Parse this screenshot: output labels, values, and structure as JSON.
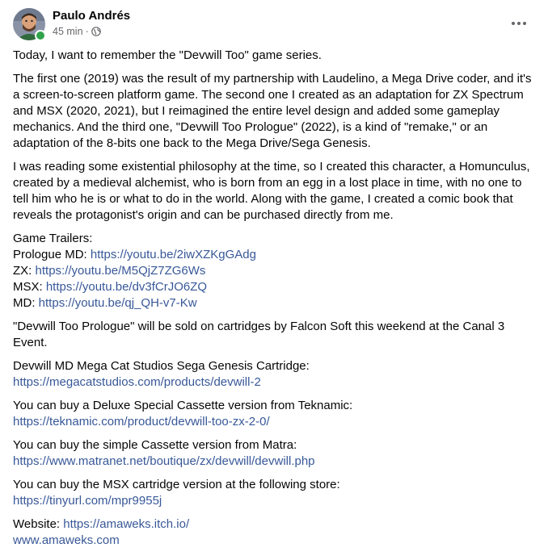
{
  "post": {
    "author": "Paulo Andrés",
    "time": "45 min",
    "dot": "·",
    "icons": {
      "avatar": "avatar-icon",
      "globe": "globe-icon",
      "more": "more-options-icon"
    },
    "colors": {
      "link": "#385898",
      "online": "#31a24c",
      "meta": "#65676b"
    }
  },
  "body": {
    "p1": "Today, I want to remember the \"Devwill Too\" game series.",
    "p2": [
      "The first one (2019) was the result of my partnership with Laudelino, a Mega Drive coder, and it's",
      "a screen-to-screen platform game. The second one I created as an adaptation for ZX Spectrum",
      "and MSX (2020, 2021), but I reimagined the entire level design and added some gameplay",
      "mechanics. And the third one, \"Devwill Too Prologue\" (2022), is a kind of \"remake,\" or an",
      "adaptation of the  8-bits one back to the Mega Drive/Sega Genesis."
    ],
    "p3": [
      "I was reading some existential philosophy at the time, so I created this character, a Homunculus,",
      "created by a medieval alchemist, who is born from an egg in a lost place in time, with no one to",
      "tell him who he is or what to do in the world. Along with the game, I created a comic book that",
      "reveals the protagonist's origin and can be purchased directly from me."
    ],
    "trailers_heading": "Game Trailers:",
    "trailers": [
      {
        "label": "Prologue MD: ",
        "link": "https://youtu.be/2iwXZKgGAdg"
      },
      {
        "label": "ZX: ",
        "link": "https://youtu.be/M5QjZ7ZG6Ws"
      },
      {
        "label": "MSX: ",
        "link": "https://youtu.be/dv3fCrJO6ZQ"
      },
      {
        "label": "MD: ",
        "link": "https://youtu.be/qj_QH-v7-Kw"
      }
    ],
    "p_sold": "\"Devwill Too Prologue\" will be sold on cartridges by Falcon Soft this weekend at the Canal 3 Event.",
    "stores": [
      {
        "text": "Devwill MD Mega Cat Studios Sega Genesis Cartridge:",
        "link": "https://megacatstudios.com/products/devwill-2"
      },
      {
        "text": "You can buy a Deluxe Special Cassette version from Teknamic:",
        "link": "https://teknamic.com/product/devwill-too-zx-2-0/"
      },
      {
        "text": "You can buy the simple Cassette version from Matra:",
        "link": "https://www.matranet.net/boutique/zx/devwill/devwill.php"
      },
      {
        "text": "You can buy the MSX cartridge version at the following store:",
        "link": "https://tinyurl.com/mpr9955j"
      }
    ],
    "website_label": "Website: ",
    "website_link": "https://amaweks.itch.io/",
    "website_link2": "www.amaweks.com"
  }
}
